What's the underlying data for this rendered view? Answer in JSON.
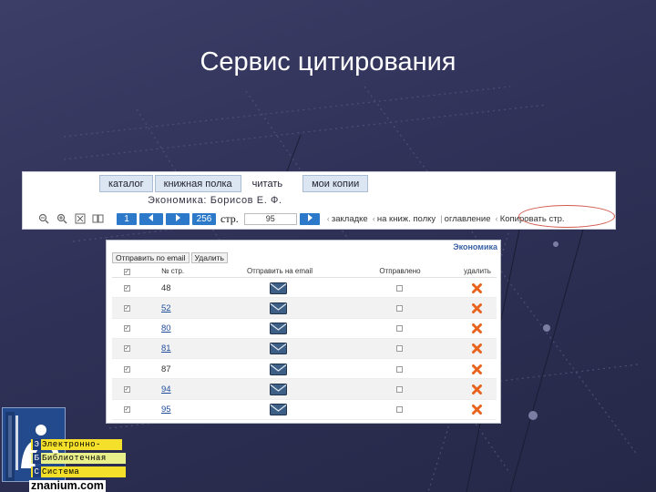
{
  "slide": {
    "title": "Сервис цитирования"
  },
  "toolbar": {
    "tabs": [
      {
        "label": "каталог",
        "active": false
      },
      {
        "label": "книжная полка",
        "active": false
      },
      {
        "label": "читать",
        "active": true
      },
      {
        "label": "мои копии",
        "active": false
      }
    ],
    "book_title": "Экономика: Борисов Е. Ф.",
    "first_page": "1",
    "prev_icon": "triangle-left-icon",
    "next_icon": "triangle-right-icon",
    "total_pages": "256",
    "page_word": "стр.",
    "page_value": "95",
    "links": [
      "закладке",
      "на книж. полку",
      "оглавление",
      "Копировать стр."
    ],
    "icons": [
      "zoom-out-icon",
      "zoom-in-icon",
      "fit-page-icon",
      "two-page-icon"
    ],
    "highlight_color": "#d25a4e"
  },
  "table_panel": {
    "title": "Экономика",
    "actions": [
      "Отправить по email",
      "Удалить"
    ],
    "headers": [
      "№ стр.",
      "Отправить на email",
      "Отправлено",
      "удалить"
    ],
    "rows": [
      {
        "page": "48",
        "linked": false,
        "checked": true,
        "sent": false
      },
      {
        "page": "52",
        "linked": true,
        "checked": true,
        "sent": false
      },
      {
        "page": "80",
        "linked": true,
        "checked": true,
        "sent": false
      },
      {
        "page": "81",
        "linked": true,
        "checked": true,
        "sent": false
      },
      {
        "page": "87",
        "linked": false,
        "checked": true,
        "sent": false
      },
      {
        "page": "94",
        "linked": true,
        "checked": true,
        "sent": false
      },
      {
        "page": "95",
        "linked": true,
        "checked": true,
        "sent": false
      }
    ],
    "mail_icon": "envelope-icon",
    "delete_icon": "red-cross-icon",
    "delete_color": "#e8641e"
  },
  "logo": {
    "lines": [
      "Электронно-",
      "Библиотечная",
      "Система"
    ],
    "url": "znanium.com"
  }
}
